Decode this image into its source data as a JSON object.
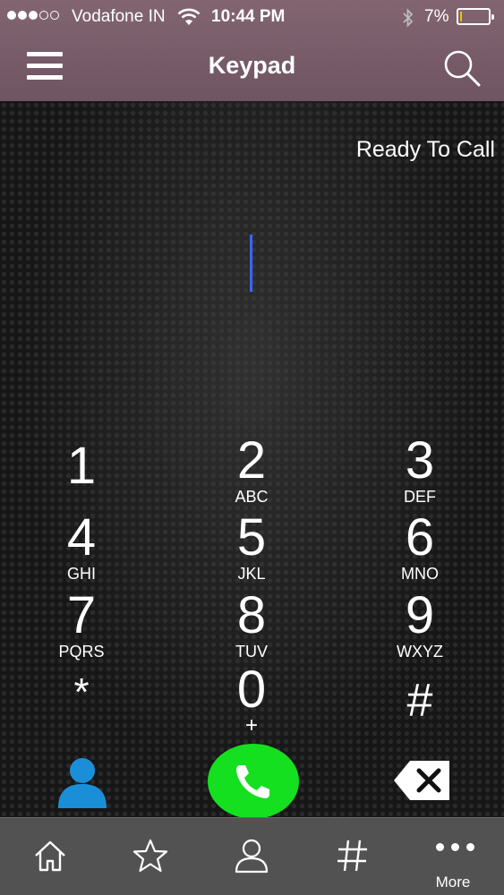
{
  "status_bar": {
    "carrier": "Vodafone IN",
    "time": "10:44 PM",
    "battery_percent": "7%",
    "battery_level": 0.07
  },
  "header": {
    "title": "Keypad",
    "menu_icon": "hamburger-menu-icon",
    "search_icon": "search-icon"
  },
  "dialer": {
    "status_text": "Ready To Call",
    "number": ""
  },
  "keypad": {
    "keys": [
      {
        "digit": "1",
        "letters": ""
      },
      {
        "digit": "2",
        "letters": "ABC"
      },
      {
        "digit": "3",
        "letters": "DEF"
      },
      {
        "digit": "4",
        "letters": "GHI"
      },
      {
        "digit": "5",
        "letters": "JKL"
      },
      {
        "digit": "6",
        "letters": "MNO"
      },
      {
        "digit": "7",
        "letters": "PQRS"
      },
      {
        "digit": "8",
        "letters": "TUV"
      },
      {
        "digit": "9",
        "letters": "WXYZ"
      },
      {
        "digit": "*",
        "letters": ""
      },
      {
        "digit": "0",
        "letters": "+"
      },
      {
        "digit": "#",
        "letters": ""
      }
    ]
  },
  "actions": {
    "contacts_icon": "contact-person-icon",
    "call_icon": "phone-icon",
    "delete_icon": "backspace-icon"
  },
  "colors": {
    "header": "#7a5e6b",
    "call_button": "#14e020",
    "contact_icon": "#1a8fd8",
    "cursor": "#3a66ff",
    "tabbar": "#525252"
  },
  "tabbar": {
    "tabs": [
      {
        "icon": "home-icon",
        "label": ""
      },
      {
        "icon": "star-icon",
        "label": ""
      },
      {
        "icon": "person-icon",
        "label": ""
      },
      {
        "icon": "hash-icon",
        "label": ""
      },
      {
        "icon": "more-dots-icon",
        "label": "More"
      }
    ]
  }
}
